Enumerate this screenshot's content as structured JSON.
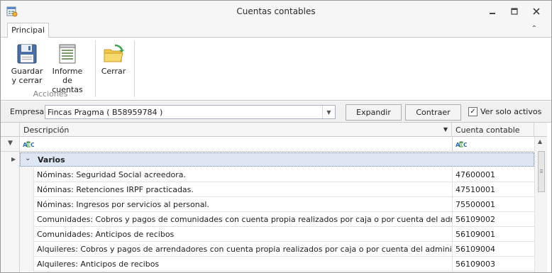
{
  "window": {
    "title": "Cuentas contables",
    "minimize_icon": "minimize-icon",
    "maximize_icon": "maximize-icon",
    "close_icon": "close-icon"
  },
  "ribbon": {
    "tabs": [
      {
        "label": "Principal"
      }
    ],
    "buttons": [
      {
        "label_line1": "Guardar",
        "label_line2": "y cerrar",
        "icon": "floppy-disk-icon"
      },
      {
        "label_line1": "Informe de",
        "label_line2": "cuentas",
        "icon": "report-icon"
      },
      {
        "label_line1": "Cerrar",
        "label_line2": "",
        "icon": "folder-exit-icon"
      }
    ],
    "group_label": "Acciones"
  },
  "filter": {
    "empresa_label": "Empresa:",
    "empresa_value": "Fincas Pragma ( B58959784 )",
    "expand_label": "Expandir",
    "collapse_label": "Contraer",
    "only_active_label": "Ver solo activos",
    "only_active_checked": true
  },
  "grid": {
    "columns": [
      {
        "label": "Descripción"
      },
      {
        "label": "Cuenta contable"
      }
    ],
    "filter_glyph": "ABC",
    "group": {
      "label": "Varios"
    },
    "rows": [
      {
        "description": "Nóminas: Seguridad Social acreedora.",
        "account": "47600001"
      },
      {
        "description": "Nóminas: Retenciones IRPF practicadas.",
        "account": "47510001"
      },
      {
        "description": "Nóminas: Ingresos por servicios al personal.",
        "account": "75500001"
      },
      {
        "description": "Comunidades: Cobros y pagos de comunidades con cuenta propia realizados por caja o por cuenta del administrador",
        "account": "56109002"
      },
      {
        "description": "Comunidades: Anticipos de recibos",
        "account": "56109001"
      },
      {
        "description": "Alquileres: Cobros y pagos de arrendadores con cuenta propia realizados por caja o por cuenta del administrador",
        "account": "56109004"
      },
      {
        "description": "Alquileres: Anticipos de recibos",
        "account": "56109003"
      }
    ]
  },
  "colors": {
    "accent": "#dde7f3",
    "header_bg": "#f5f5f5",
    "border": "#c8c8c8"
  }
}
